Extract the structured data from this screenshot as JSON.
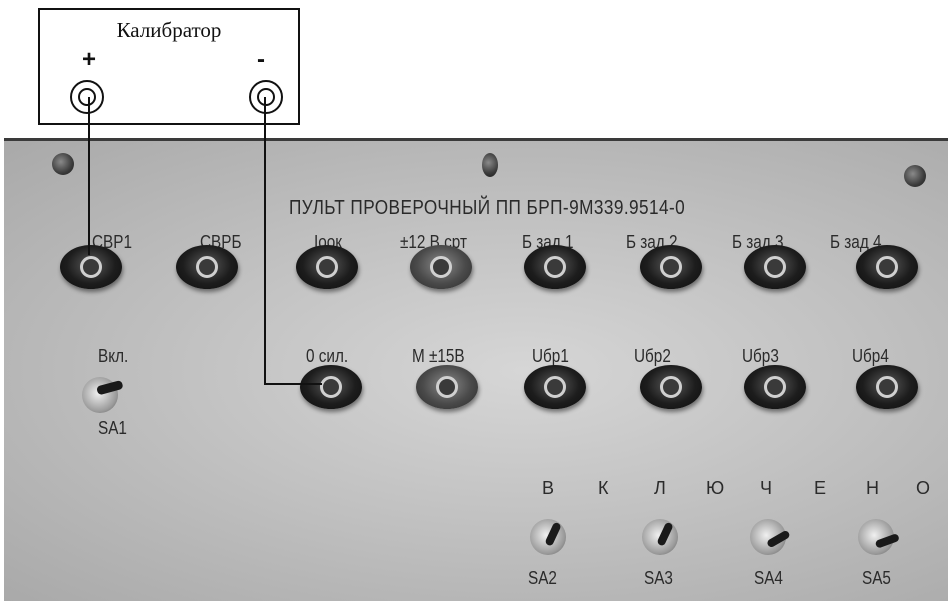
{
  "calibrator": {
    "title": "Калибратор",
    "plus": "+",
    "minus": "-"
  },
  "panel": {
    "title": "ПУЛЬТ ПРОВЕРОЧНЫЙ ПП БРП-9М339.9514-0",
    "top_row": [
      "СВР1",
      "СВРБ",
      "Iоок",
      "±12 В срт",
      "Б зад 1",
      "Б зад 2",
      "Б зад 3",
      "Б зад 4"
    ],
    "mid_row": [
      "0 сил.",
      "М ±15В",
      "Uбр1",
      "Uбр2",
      "Uбр3",
      "Uбр4"
    ],
    "power_switch": {
      "on_label": "Вкл.",
      "name": "SA1"
    },
    "bottom_word": [
      "В",
      "К",
      "Л",
      "Ю",
      "Ч",
      "Е",
      "Н",
      "О"
    ],
    "bottom_switches": [
      "SA2",
      "SA3",
      "SA4",
      "SA5"
    ]
  },
  "colors": {
    "panel": "#c4c4c4",
    "jack": "#1d1d1d",
    "wire": "#111111"
  }
}
